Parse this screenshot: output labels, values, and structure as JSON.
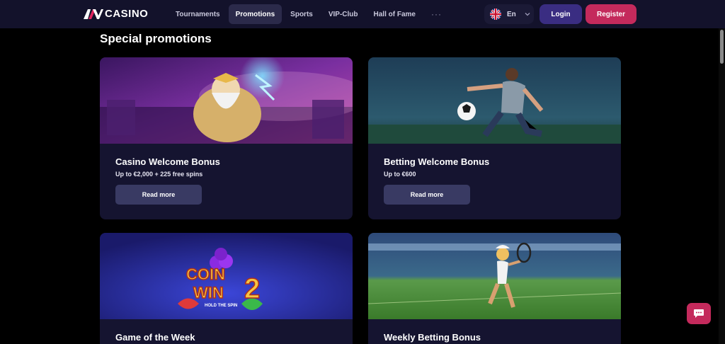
{
  "brand": {
    "name": "CASINO"
  },
  "nav": {
    "items": [
      {
        "label": "Tournaments"
      },
      {
        "label": "Promotions"
      },
      {
        "label": "Sports"
      },
      {
        "label": "VIP-Club"
      },
      {
        "label": "Hall of Fame"
      }
    ],
    "more": "···"
  },
  "lang": {
    "label": "En"
  },
  "auth": {
    "login": "Login",
    "register": "Register"
  },
  "page": {
    "title": "Special promotions"
  },
  "promos": [
    {
      "title": "Casino Welcome Bonus",
      "subtitle": "Up to €2,000 + 225 free spins",
      "button": "Read more"
    },
    {
      "title": "Betting Welcome Bonus",
      "subtitle": "Up to €600",
      "button": "Read more"
    },
    {
      "title": "Game of the Week",
      "subtitle": "",
      "button": ""
    },
    {
      "title": "Weekly Betting Bonus",
      "subtitle": "",
      "button": ""
    }
  ],
  "promo_art": {
    "game_logo_line1": "COIN",
    "game_logo_line2": "WIN",
    "game_logo_number": "2",
    "game_logo_tagline": "HOLD THE SPIN"
  },
  "colors": {
    "header_bg": "#13122b",
    "card_bg": "#151430",
    "login": "#3a2d82",
    "register": "#c42a5c",
    "card_button": "#393a63"
  }
}
